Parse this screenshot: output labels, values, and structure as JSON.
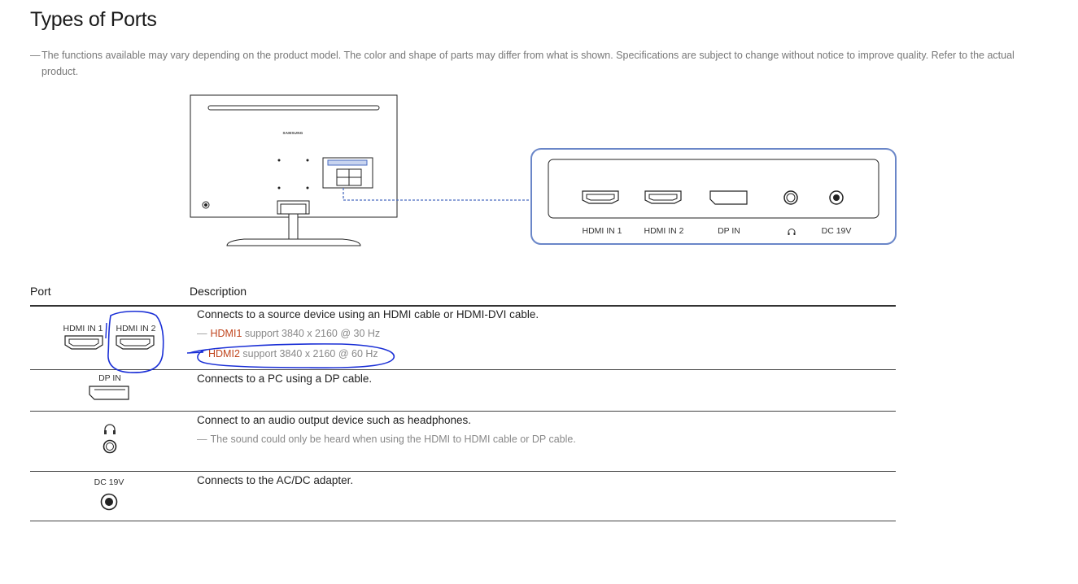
{
  "page": {
    "title": "Types of Ports",
    "note": "The functions available may vary depending on the product model. The color and shape of parts may differ from what is shown. Specifications are subject to change without notice to improve quality. Refer to the actual product.",
    "note_dash": "—"
  },
  "diagram": {
    "brand": "SAMSUNG",
    "port_labels": [
      "HDMI IN 1",
      "HDMI IN 2",
      "DP IN",
      "headphone-icon",
      "DC 19V"
    ]
  },
  "table": {
    "headers": {
      "port": "Port",
      "description": "Description"
    },
    "rows": [
      {
        "port_labels": [
          "HDMI IN 1",
          "HDMI IN 2"
        ],
        "description": "Connects to a source device using an HDMI cable or HDMI-DVI cable.",
        "notes": [
          {
            "highlight": "HDMI1",
            "text": " support 3840 x 2160 @ 30 Hz"
          },
          {
            "highlight": "HDMI2",
            "text": " support 3840 x 2160 @ 60 Hz"
          }
        ]
      },
      {
        "port_labels": [
          "DP IN"
        ],
        "description": "Connects to a PC using a DP cable."
      },
      {
        "port_labels": [
          "headphone-icon"
        ],
        "description": "Connect to an audio output device such as headphones.",
        "notes": [
          {
            "highlight": "",
            "text": "The sound could only be heard when using the HDMI to HDMI cable or DP cable."
          }
        ]
      },
      {
        "port_labels": [
          "DC 19V"
        ],
        "description": "Connects to the AC/DC adapter."
      }
    ]
  },
  "annotations": {
    "color": "#1a2fd6",
    "description": "blue pen circles around HDMI IN 2 port and HDMI2 support note"
  },
  "colors": {
    "highlight": "#c0441c",
    "callout_border": "#6a86c8",
    "annotation": "#1a2fd6"
  }
}
